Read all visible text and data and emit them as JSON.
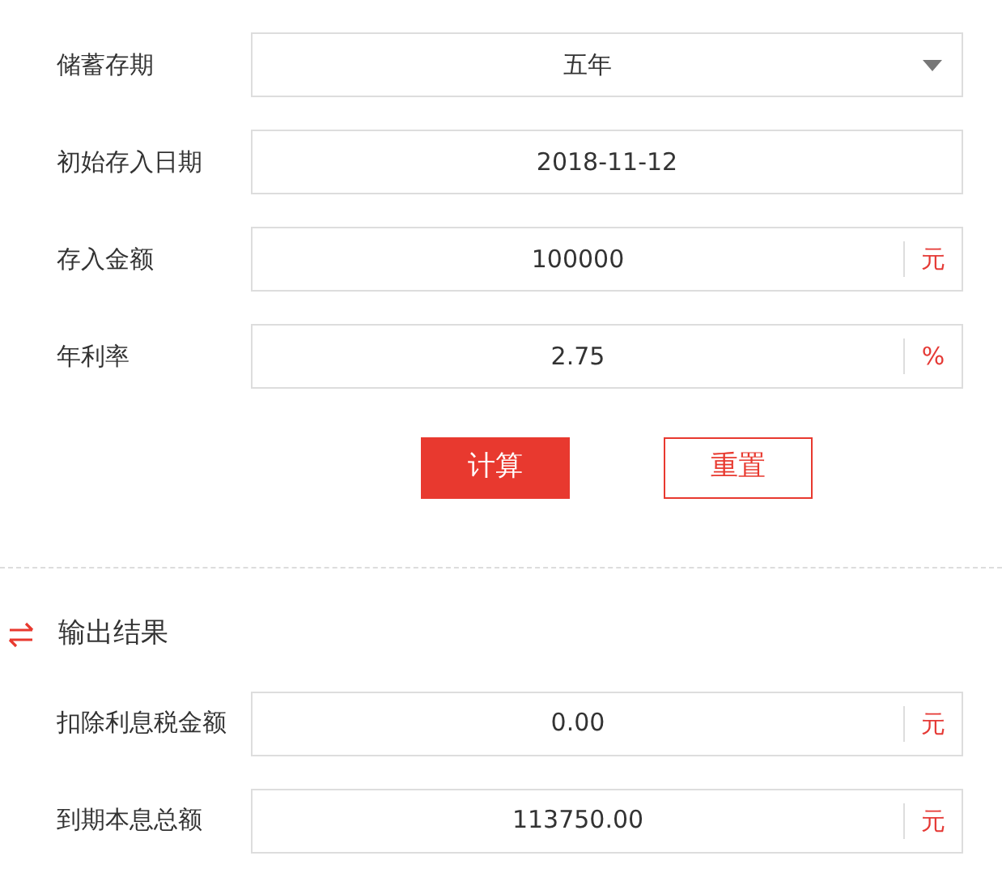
{
  "inputs": [
    {
      "kind": "select",
      "label": "储蓄存期",
      "value": "五年"
    },
    {
      "kind": "text",
      "label": "初始存入日期",
      "value": "2018-11-12"
    },
    {
      "kind": "unit",
      "label": "存入金额",
      "value": "100000",
      "unit": "元"
    },
    {
      "kind": "unit",
      "label": "年利率",
      "value": "2.75",
      "unit": "%"
    }
  ],
  "buttons": [
    {
      "kind": "primary",
      "label": "计算"
    },
    {
      "kind": "outline",
      "label": "重置"
    }
  ],
  "output": {
    "title": "输出结果",
    "rows": [
      {
        "kind": "unit",
        "label": "扣除利息税金额",
        "value": "0.00",
        "unit": "元"
      },
      {
        "kind": "unit",
        "label": "到期本息总额",
        "value": "113750.00",
        "unit": "元"
      }
    ]
  }
}
